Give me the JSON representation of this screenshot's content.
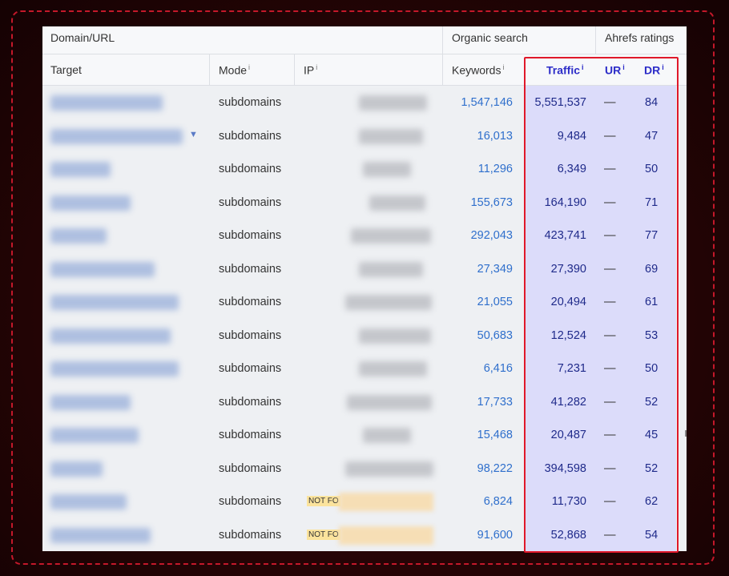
{
  "header": {
    "group_domain": "Domain/URL",
    "group_organic": "Organic search",
    "group_ratings": "Ahrefs ratings",
    "col_target": "Target",
    "col_mode": "Mode",
    "col_ip": "IP",
    "col_keywords": "Keywords",
    "col_traffic": "Traffic",
    "col_ur": "UR",
    "col_dr": "DR",
    "info_mark": "i"
  },
  "not_found_label": "NOT FO",
  "colors": {
    "highlight_border": "#e0182a",
    "highlight_fill": "#dcdcfa",
    "link_blue": "#2f6fcc"
  },
  "rows": [
    {
      "mode": "subdomains",
      "keywords": "1,547,146",
      "traffic": "5,551,537",
      "ur": "—",
      "dr": "84"
    },
    {
      "mode": "subdomains",
      "keywords": "16,013",
      "traffic": "9,484",
      "ur": "—",
      "dr": "47"
    },
    {
      "mode": "subdomains",
      "keywords": "11,296",
      "traffic": "6,349",
      "ur": "—",
      "dr": "50"
    },
    {
      "mode": "subdomains",
      "keywords": "155,673",
      "traffic": "164,190",
      "ur": "—",
      "dr": "71"
    },
    {
      "mode": "subdomains",
      "keywords": "292,043",
      "traffic": "423,741",
      "ur": "—",
      "dr": "77"
    },
    {
      "mode": "subdomains",
      "keywords": "27,349",
      "traffic": "27,390",
      "ur": "—",
      "dr": "69"
    },
    {
      "mode": "subdomains",
      "keywords": "21,055",
      "traffic": "20,494",
      "ur": "—",
      "dr": "61"
    },
    {
      "mode": "subdomains",
      "keywords": "50,683",
      "traffic": "12,524",
      "ur": "—",
      "dr": "53"
    },
    {
      "mode": "subdomains",
      "keywords": "6,416",
      "traffic": "7,231",
      "ur": "—",
      "dr": "50"
    },
    {
      "mode": "subdomains",
      "keywords": "17,733",
      "traffic": "41,282",
      "ur": "—",
      "dr": "52"
    },
    {
      "mode": "subdomains",
      "keywords": "15,468",
      "traffic": "20,487",
      "ur": "—",
      "dr": "45"
    },
    {
      "mode": "subdomains",
      "keywords": "98,222",
      "traffic": "394,598",
      "ur": "—",
      "dr": "52"
    },
    {
      "mode": "subdomains",
      "keywords": "6,824",
      "traffic": "11,730",
      "ur": "—",
      "dr": "62"
    },
    {
      "mode": "subdomains",
      "keywords": "91,600",
      "traffic": "52,868",
      "ur": "—",
      "dr": "54"
    }
  ]
}
